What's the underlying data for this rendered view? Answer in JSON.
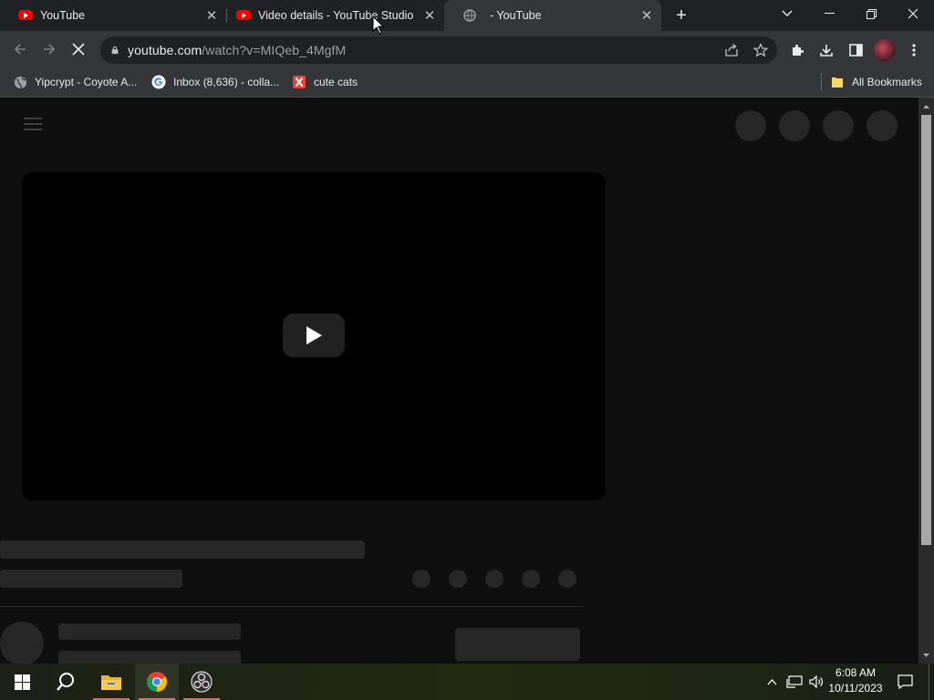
{
  "tabs": [
    {
      "title": "YouTube",
      "favicon": "youtube-icon"
    },
    {
      "title": "Video details - YouTube Studio",
      "favicon": "youtube-icon"
    },
    {
      "title": "- YouTube",
      "favicon": "loading-globe-icon",
      "active": true
    }
  ],
  "toolbar": {
    "url_host": "youtube.com",
    "url_rest": "/watch?v=MIQeb_4MgfM"
  },
  "bookmarks": [
    {
      "label": "Yipcrypt - Coyote A...",
      "icon": "globe-icon"
    },
    {
      "label": "Inbox (8,636) - colla...",
      "icon": "google-icon"
    },
    {
      "label": "cute cats",
      "icon": "x-logo-icon"
    }
  ],
  "bookmarks_right": {
    "label": "All Bookmarks",
    "icon": "folder-icon"
  },
  "clock": {
    "time": "6:08 AM",
    "date": "10/11/2023"
  },
  "colors": {
    "tab_strip": "#202124",
    "toolbar": "#35363a",
    "page": "#0f0f0f",
    "skeleton": "#272727",
    "youtube_red": "#ff0000"
  }
}
